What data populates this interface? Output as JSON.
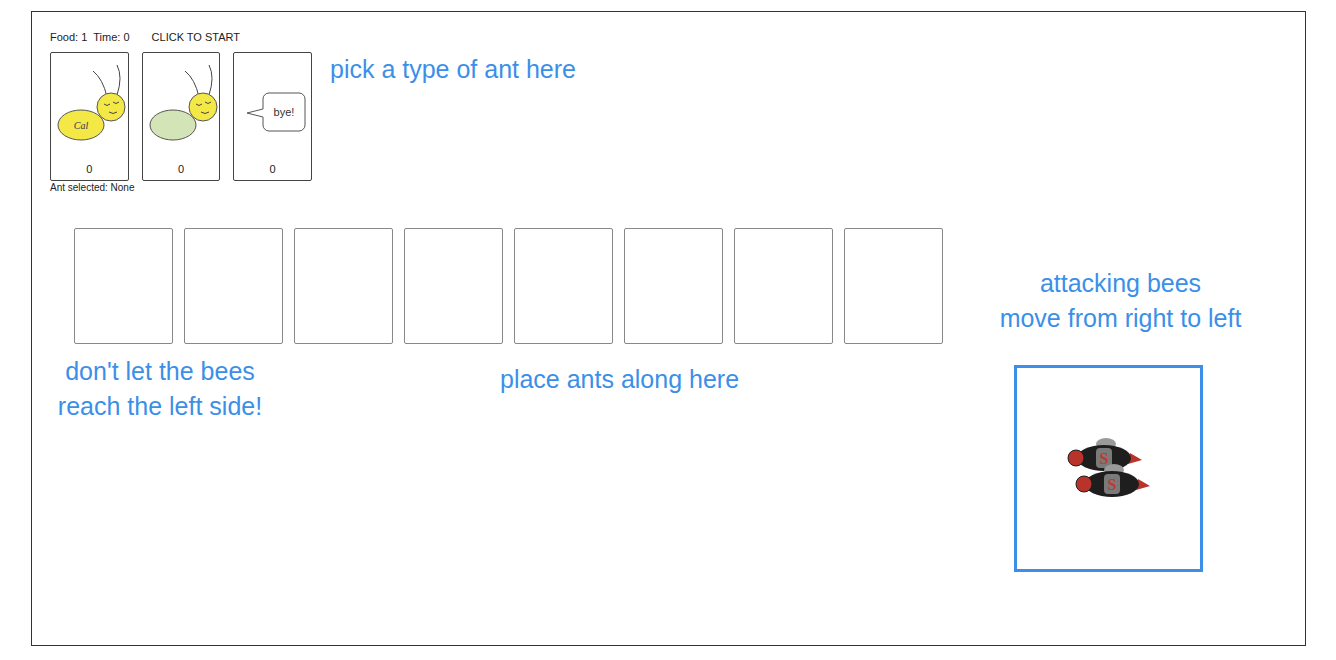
{
  "status": {
    "food": "Food: 1",
    "time": "Time: 0",
    "action": "CLICK TO START"
  },
  "ant_types": [
    {
      "kind": "harvester",
      "badge": "Cal",
      "count": "0",
      "selected": false
    },
    {
      "kind": "thrower",
      "count": "0",
      "selected": false
    },
    {
      "kind": "bye",
      "bubble": "bye!",
      "count": "0",
      "selected": false
    }
  ],
  "ant_selected": "Ant selected: None",
  "places": [
    {
      "occupied": false
    },
    {
      "occupied": false
    },
    {
      "occupied": false
    },
    {
      "occupied": false
    },
    {
      "occupied": false
    },
    {
      "occupied": false
    },
    {
      "occupied": false
    },
    {
      "occupied": false
    }
  ],
  "hive": {
    "bees": [
      {
        "badge": "S"
      },
      {
        "badge": "S"
      }
    ]
  },
  "annotations": {
    "pick": "pick a type of ant here",
    "bees": [
      "attacking bees",
      "move from right to left"
    ],
    "goal": [
      "don't let the bees",
      "reach the left side!"
    ],
    "place": "place ants along here"
  }
}
